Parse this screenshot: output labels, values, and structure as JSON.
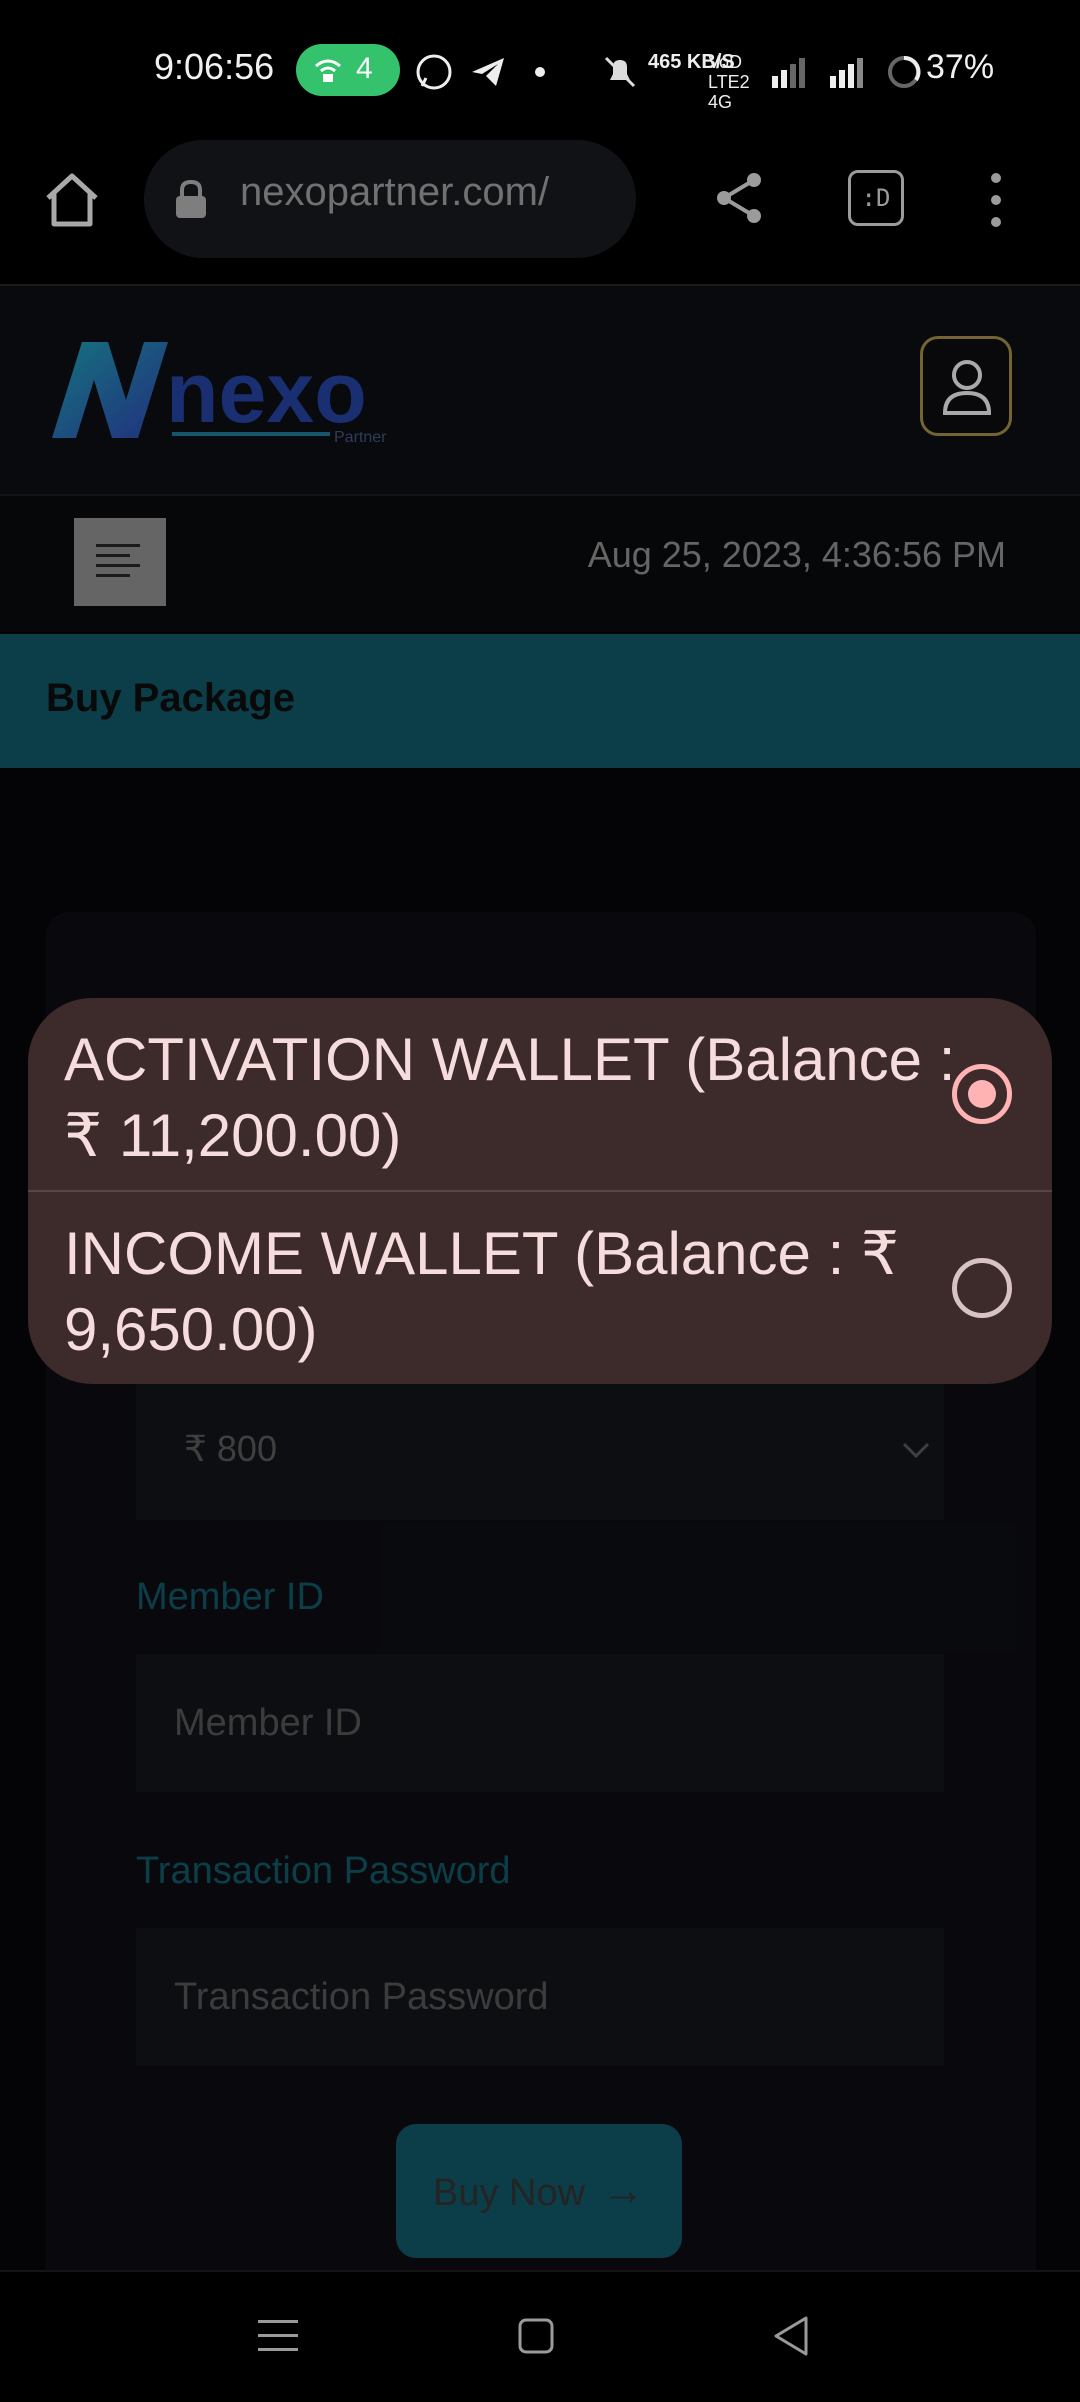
{
  "status_bar": {
    "time": "9:06:56",
    "hotspot_count": "4",
    "data_speed": "465 KB/S",
    "network": "VoD LTE2 4G",
    "battery": "37%"
  },
  "browser": {
    "url": "nexopartner.com/",
    "tabs_label": ":D"
  },
  "header": {
    "logo_text": "nexo",
    "logo_sub": "Partner",
    "datetime": "Aug 25, 2023, 4:36:56 PM"
  },
  "page": {
    "title": "Buy Package",
    "amount_selected": "₹ 800",
    "member_id_label": "Member ID",
    "member_id_placeholder": "Member ID",
    "tx_password_label": "Transaction Password",
    "tx_password_placeholder": "Transaction Password",
    "buy_button_label": "Buy Now",
    "buy_button_arrow": "→"
  },
  "wallet_popup": {
    "options": [
      {
        "label": "ACTIVATION WALLET (Balance : ₹ 11,200.00)",
        "selected": true
      },
      {
        "label": "INCOME WALLET (Balance : ₹ 9,650.00)",
        "selected": false
      }
    ]
  },
  "colors": {
    "accent_teal": "#0e4c58",
    "popup_bg": "#3d2a2b",
    "radio_selected": "#ffb3b3",
    "hotspot_green": "#35c26c"
  }
}
